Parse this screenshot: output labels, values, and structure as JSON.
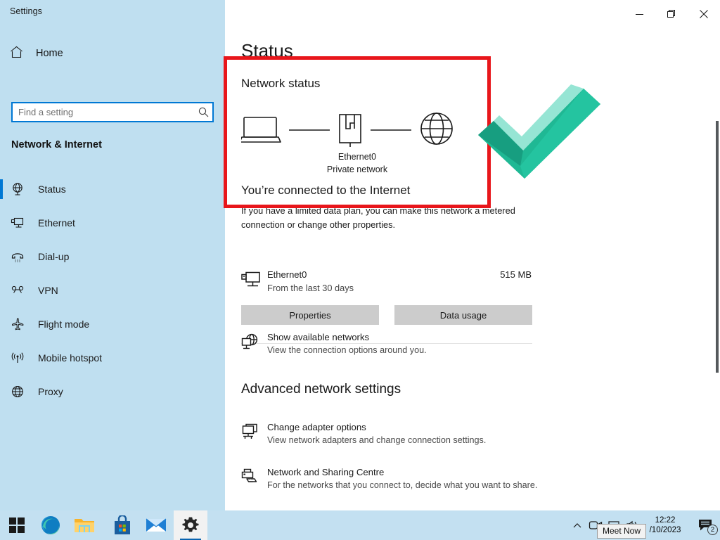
{
  "window": {
    "title": "Settings",
    "controls": {
      "minimize": "minimize-button",
      "restore": "restore-button",
      "close": "close-button"
    }
  },
  "sidebar": {
    "home_label": "Home",
    "search": {
      "value": "",
      "placeholder": "Find a setting"
    },
    "category": "Network & Internet",
    "items": [
      {
        "label": "Status",
        "icon": "globe-stand-icon",
        "selected": true
      },
      {
        "label": "Ethernet",
        "icon": "ethernet-icon",
        "selected": false
      },
      {
        "label": "Dial-up",
        "icon": "telephone-icon",
        "selected": false
      },
      {
        "label": "VPN",
        "icon": "vpn-key-icon",
        "selected": false
      },
      {
        "label": "Flight mode",
        "icon": "airplane-icon",
        "selected": false
      },
      {
        "label": "Mobile hotspot",
        "icon": "hotspot-waves-icon",
        "selected": false
      },
      {
        "label": "Proxy",
        "icon": "globe-icon",
        "selected": false
      }
    ]
  },
  "main": {
    "page_title": "Status",
    "network_status": {
      "heading": "Network status",
      "device_name": "Ethernet0",
      "network_type": "Private network",
      "connection_message": "You’re connected to the Internet",
      "metered_description": "If you have a limited data plan, you can make this network a metered connection or change other properties."
    },
    "usage": {
      "adapter": "Ethernet0",
      "period": "From the last 30 days",
      "amount": "515 MB",
      "properties_button": "Properties",
      "data_usage_button": "Data usage"
    },
    "links": [
      {
        "title": "Show available networks",
        "subtitle": "View the connection options around you.",
        "icon": "available-networks-icon"
      },
      {
        "title": "Change adapter options",
        "subtitle": "View network adapters and change connection settings.",
        "icon": "adapter-options-icon"
      },
      {
        "title": "Network and Sharing Centre",
        "subtitle": "For the networks that you connect to, decide what you want to share.",
        "icon": "sharing-centre-icon"
      }
    ],
    "advanced_heading": "Advanced network settings"
  },
  "annotations": {
    "highlight_box_color": "#e8161b",
    "checkmark_color": "#1fb894"
  },
  "taskbar": {
    "apps": [
      {
        "name": "start-button",
        "icon": "windows-logo-icon"
      },
      {
        "name": "edge-button",
        "icon": "edge-icon"
      },
      {
        "name": "file-explorer-button",
        "icon": "folder-icon"
      },
      {
        "name": "store-button",
        "icon": "store-bag-icon"
      },
      {
        "name": "mail-button",
        "icon": "mail-envelope-icon"
      },
      {
        "name": "settings-button",
        "icon": "gear-icon"
      }
    ],
    "tooltip": "Meet Now",
    "clock": {
      "time": "12:22",
      "date": "/10/2023"
    },
    "notifications_count": "2"
  }
}
